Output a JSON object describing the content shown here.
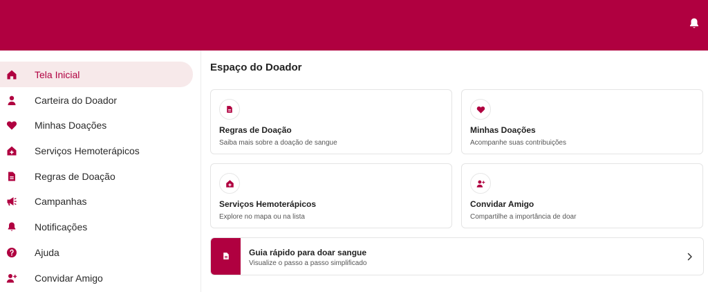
{
  "colors": {
    "brand": "#b00040",
    "active_bg": "#f7e9ea",
    "icon_white": "#ffffff"
  },
  "header": {
    "notification_icon": "bell-icon"
  },
  "sidebar": {
    "items": [
      {
        "label": "Tela Inicial",
        "icon": "home-icon",
        "active": true
      },
      {
        "label": "Carteira do Doador",
        "icon": "person-icon"
      },
      {
        "label": "Minhas Doações",
        "icon": "heart-icon"
      },
      {
        "label": "Serviços Hemoterápicos",
        "icon": "medical-home-icon"
      },
      {
        "label": "Regras de Doação",
        "icon": "document-icon"
      },
      {
        "label": "Campanhas",
        "icon": "megaphone-icon"
      },
      {
        "label": "Notificações",
        "icon": "bell-icon"
      },
      {
        "label": "Ajuda",
        "icon": "help-icon"
      },
      {
        "label": "Convidar Amigo",
        "icon": "person-add-icon"
      }
    ]
  },
  "main": {
    "title": "Espaço do Doador",
    "cards": [
      {
        "title": "Regras de Doação",
        "subtitle": "Saiba mais sobre a doação de sangue",
        "icon": "document-icon"
      },
      {
        "title": "Minhas Doações",
        "subtitle": "Acompanhe suas contribuições",
        "icon": "heart-icon"
      },
      {
        "title": "Serviços Hemoterápicos",
        "subtitle": "Explore no mapa ou na lista",
        "icon": "medical-home-icon"
      },
      {
        "title": "Convidar Amigo",
        "subtitle": "Compartilhe a importância de doar",
        "icon": "person-add-icon"
      }
    ],
    "guide": {
      "title": "Guia rápido para doar sangue",
      "subtitle": "Visualize o passo a passo simplificado",
      "icon": "document-icon",
      "chevron": "chevron-right-icon"
    }
  }
}
